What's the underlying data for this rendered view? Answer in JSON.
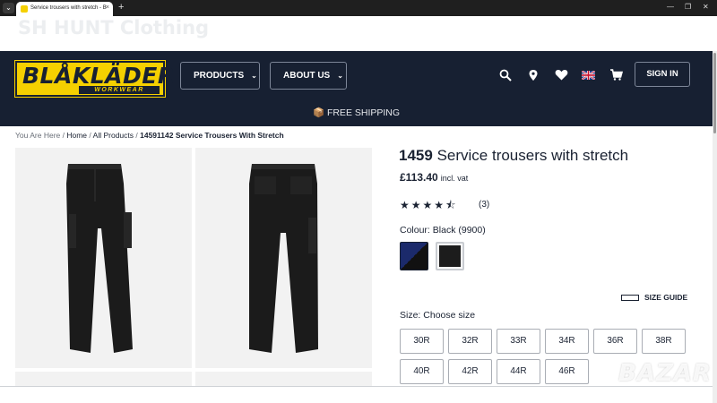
{
  "browser": {
    "tab_title": "Service trousers with stretch - B",
    "tab_close": "×",
    "new_tab": "+"
  },
  "site": {
    "ghost_title": "SH HUNT Clothing",
    "logo_text": "BLÅKLÄDER",
    "logo_sub": "WORKWEAR",
    "nav_products": "PRODUCTS",
    "nav_about": "ABOUT US",
    "sign_in": "SIGN IN",
    "shipping": "FREE SHIPPING"
  },
  "breadcrumb": {
    "prefix": "You Are Here",
    "home": "Home",
    "all_products": "All Products",
    "current": "14591142 Service Trousers With Stretch"
  },
  "product": {
    "code": "1459",
    "name": "Service trousers with stretch",
    "price": "£113.40",
    "vat": "incl. vat",
    "rating": 4.5,
    "review_count": "(3)",
    "colour_label": "Colour:",
    "colour_value": "Black (9900)",
    "swatches": [
      {
        "name": "navy-black",
        "colors": [
          "#1b2a6b",
          "#111111"
        ]
      },
      {
        "name": "black",
        "colors": [
          "#1c1c1c",
          "#1c1c1c"
        ]
      }
    ],
    "size_guide": "SIZE GUIDE",
    "size_label": "Size:",
    "size_value": "Choose size",
    "sizes": [
      "30R",
      "32R",
      "33R",
      "34R",
      "36R",
      "38R",
      "40R",
      "42R",
      "44R",
      "46R"
    ]
  },
  "watermark": "BAZAR",
  "colors": {
    "navy": "#172032",
    "brand_yellow": "#f5d000"
  }
}
